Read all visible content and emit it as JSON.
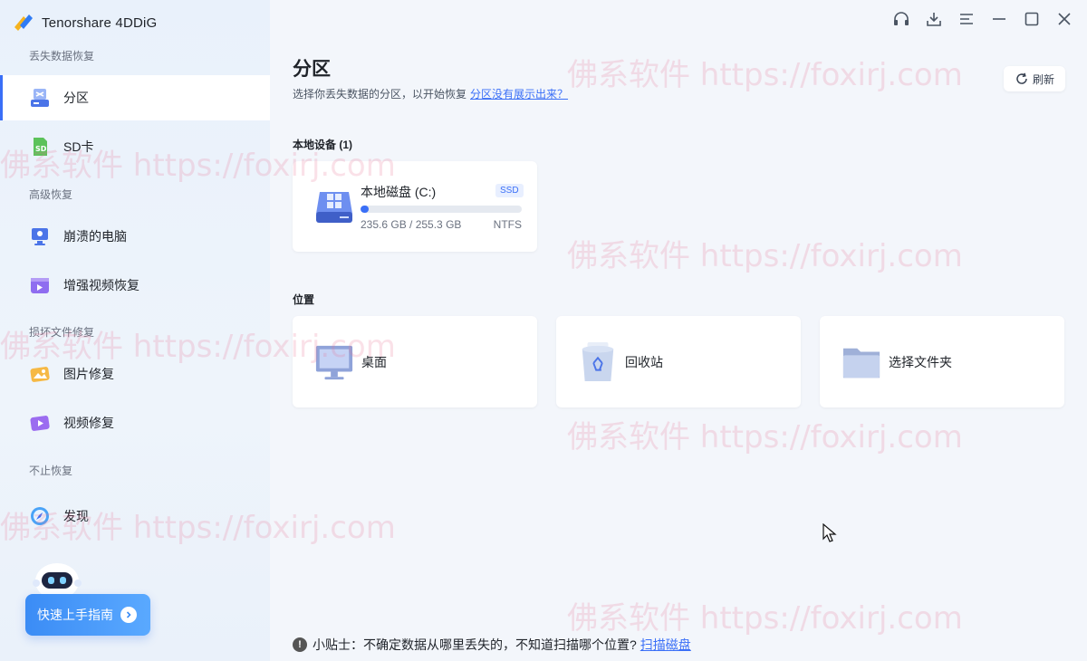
{
  "app": {
    "name": "Tenorshare 4DDiG"
  },
  "sidebar": {
    "sections": [
      {
        "title": "丢失数据恢复"
      },
      {
        "title": "高级恢复"
      },
      {
        "title": "损坏文件修复"
      },
      {
        "title": "不止恢复"
      }
    ],
    "items": [
      {
        "label": "分区",
        "icon": "partition-icon",
        "active": true
      },
      {
        "label": "SD卡",
        "icon": "sd-card-icon"
      },
      {
        "label": "崩溃的电脑",
        "icon": "crashed-pc-icon"
      },
      {
        "label": "增强视频恢复",
        "icon": "video-recovery-icon"
      },
      {
        "label": "图片修复",
        "icon": "photo-repair-icon"
      },
      {
        "label": "视频修复",
        "icon": "video-repair-icon"
      },
      {
        "label": "发现",
        "icon": "discover-icon"
      }
    ],
    "guide_button": "快速上手指南"
  },
  "header": {
    "title": "分区",
    "subtitle": "选择你丢失数据的分区，以开始恢复",
    "subtitle_link": "分区没有展示出来？",
    "refresh": "刷新"
  },
  "local_devices": {
    "label": "本地设备 (1)",
    "disks": [
      {
        "name": "本地磁盘 (C:)",
        "badge": "SSD",
        "size": "235.6 GB / 255.3 GB",
        "fs": "NTFS",
        "bar_fill_percent": 5
      }
    ]
  },
  "locations": {
    "label": "位置",
    "items": [
      {
        "label": "桌面",
        "icon": "desktop-icon"
      },
      {
        "label": "回收站",
        "icon": "recycle-bin-icon"
      },
      {
        "label": "选择文件夹",
        "icon": "folder-icon"
      }
    ]
  },
  "tip": {
    "text": "小贴士：不确定数据从哪里丢失的，不知道扫描哪个位置?",
    "link": "扫描磁盘"
  },
  "watermark": "佛系软件 https://foxirj.com",
  "colors": {
    "accent": "#3a6ff7",
    "sidebar_bg": "#e9f1fb",
    "main_bg": "#f3f6fb"
  }
}
